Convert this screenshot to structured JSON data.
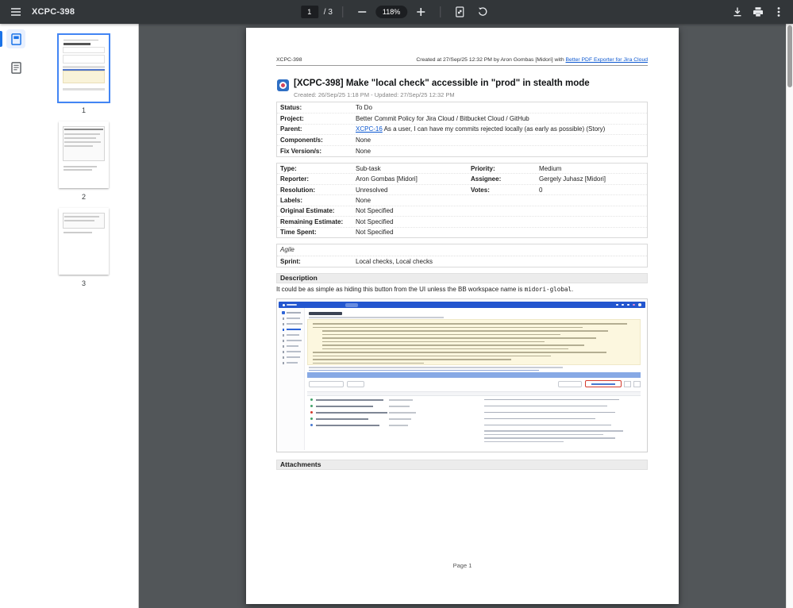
{
  "toolbar": {
    "title": "XCPC-398",
    "page_current": "1",
    "page_total_label": "/ 3",
    "zoom_label": "118%"
  },
  "sidebar": {
    "thumb_labels": [
      "1",
      "2",
      "3"
    ]
  },
  "doc": {
    "header": {
      "id": "XCPC-398",
      "created": "Created at 27/Sep/25 12:32 PM by Aron Gombas [Midori] with ",
      "exporter": "Better PDF Exporter for Jira Cloud"
    },
    "title": "[XCPC-398] Make \"local check\" accessible in \"prod\" in stealth mode",
    "dates": "Created: 26/Sep/25 1:18 PM - Updated: 27/Sep/25 12:32 PM",
    "info": [
      {
        "label": "Status:",
        "value": "To Do"
      },
      {
        "label": "Project:",
        "value": "Better Commit Policy for Jira Cloud / Bitbucket Cloud / GitHub"
      },
      {
        "label": "Parent:",
        "link": "XCPC-16",
        "value": " As a user, I can have my commits rejected locally (as early as possible) (Story)"
      },
      {
        "label": "Component/s:",
        "value": "None"
      },
      {
        "label": "Fix Version/s:",
        "value": "None"
      }
    ],
    "fields_left": [
      {
        "label": "Type:",
        "value": "Sub-task"
      },
      {
        "label": "Reporter:",
        "value": "Aron Gombas [Midori]"
      },
      {
        "label": "Resolution:",
        "value": "Unresolved"
      },
      {
        "label": "Labels:",
        "value": "None"
      },
      {
        "label": "Original Estimate:",
        "value": "Not Specified"
      },
      {
        "label": "Remaining Estimate:",
        "value": "Not Specified"
      },
      {
        "label": "Time Spent:",
        "value": "Not Specified"
      }
    ],
    "fields_right": [
      {
        "label": "Priority:",
        "value": "Medium"
      },
      {
        "label": "Assignee:",
        "value": "Gergely Juhasz [Midori]"
      },
      {
        "label": "Votes:",
        "value": "0"
      }
    ],
    "agile": {
      "header": "Agile",
      "sprint_label": "Sprint:",
      "sprint_value": "Local checks, Local checks"
    },
    "description": {
      "header": "Description",
      "text_before": "It could be as simple as hiding this button from the UI unless the BB workspace name is ",
      "code": "midori-global",
      "text_after": "."
    },
    "attachments_header": "Attachments",
    "footer": "Page 1"
  },
  "colors": {
    "accent": "#1a73e8",
    "link": "#0b57d0",
    "toolbar_bg": "#323639",
    "annotation_red": "#d33a2c"
  }
}
